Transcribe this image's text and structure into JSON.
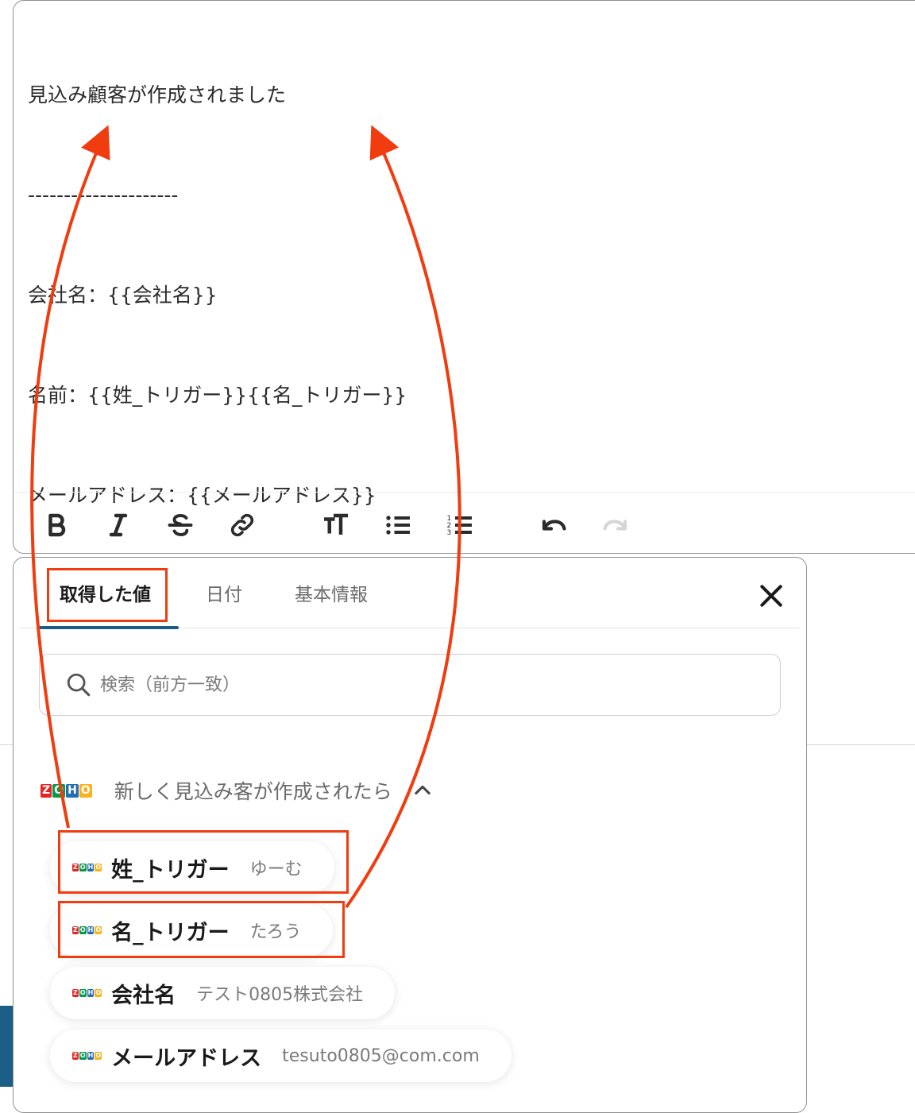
{
  "editor": {
    "lines": [
      "見込み顧客が作成されました",
      "---------------------",
      "会社名：{{会社名}}",
      "名前：{{姓_トリガー}}{{名_トリガー}}",
      "メールアドレス：{{メールアドレス}}"
    ]
  },
  "toolbar": {
    "buttons": [
      "bold",
      "italic",
      "strikethrough",
      "link",
      "text-size",
      "bulleted-list",
      "numbered-list",
      "undo",
      "redo"
    ]
  },
  "panel": {
    "tabs": [
      {
        "label": "取得した値",
        "active": true
      },
      {
        "label": "日付",
        "active": false
      },
      {
        "label": "基本情報",
        "active": false
      }
    ],
    "search": {
      "placeholder": "検索（前方一致）",
      "value": ""
    },
    "group": {
      "title": "新しく見込み客が作成されたら",
      "expanded": true,
      "logo": "ZOHO"
    },
    "items": [
      {
        "label": "姓_トリガー",
        "value": "ゆーむ"
      },
      {
        "label": "名_トリガー",
        "value": "たろう"
      },
      {
        "label": "会社名",
        "value": "テスト0805株式会社"
      },
      {
        "label": "メールアドレス",
        "value": "tesuto0805@com.com"
      }
    ]
  },
  "colors": {
    "annotation": "#f03c0f",
    "tab_underline": "#1d5a86",
    "zoho_z": "#e42527",
    "zoho_o1": "#089949",
    "zoho_h": "#226db4",
    "zoho_o2": "#f9b21d"
  }
}
